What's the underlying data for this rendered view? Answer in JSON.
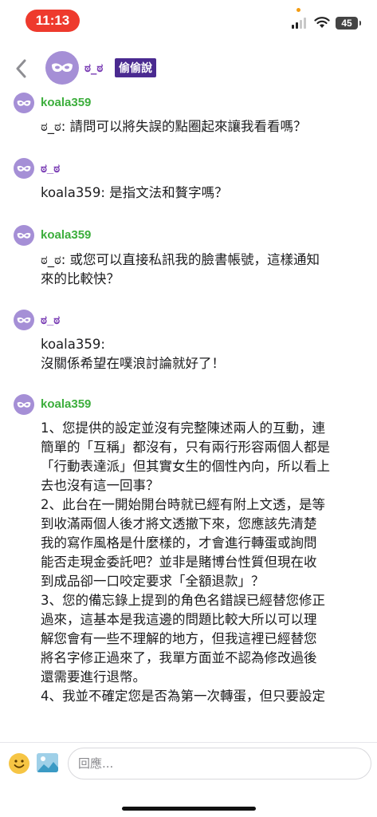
{
  "status_bar": {
    "time": "11:13",
    "battery": "45"
  },
  "header": {
    "name": "ಠ_ಠ",
    "badge": "偷偷說"
  },
  "messages": [
    {
      "author": "koala359",
      "author_color": "#3cae3c",
      "text": "ಠ_ಠ: 請問可以將失誤的點圈起來讓我看看嗎？"
    },
    {
      "author": "ಠ_ಠ",
      "author_color": "#7b3fb5",
      "text": "koala359: 是指文法和贅字嗎？"
    },
    {
      "author": "koala359",
      "author_color": "#3cae3c",
      "text": "ಠ_ಠ: 或您可以直接私訊我的臉書帳號，這樣通知\n來的比較快？"
    },
    {
      "author": "ಠ_ಠ",
      "author_color": "#7b3fb5",
      "text": "koala359:\n沒關係希望在噗浪討論就好了！"
    },
    {
      "author": "koala359",
      "author_color": "#3cae3c",
      "text": "1、您提供的設定並沒有完整陳述兩人的互動，連\n簡單的「互稱」都沒有，只有兩行形容兩個人都是\n「行動表達派」但其實女生的個性內向，所以看上\n去也沒有這一回事？\n2、此台在一開始開台時就已經有附上文透，是等\n到收滿兩個人後才將文透撤下來，您應該先清楚\n我的寫作風格是什麼樣的，才會進行轉蛋或詢問\n能否走現金委託吧？並非是賭博台性質但現在收\n到成品卻一口咬定要求「全額退款」？\n3、您的備忘錄上提到的角色名錯誤已經替您修正\n過來，這基本是我這邊的問題比較大所以可以理\n解您會有一些不理解的地方，但我這裡已經替您\n將名字修正過來了，我單方面並不認為修改過後\n還需要進行退幣。\n4、我並不確定您是否為第一次轉蛋，但只要設定"
    }
  ],
  "composer": {
    "placeholder": "回應..."
  },
  "icons": {
    "back": "chevron-left-icon",
    "avatar": "mask-icon",
    "emoji": "smiley-icon",
    "image": "image-icon"
  },
  "colors": {
    "accent_purple": "#7b3fb5",
    "badge_bg": "#4a2a90",
    "green_author": "#3cae3c",
    "time_pill": "#ee3a2d"
  }
}
